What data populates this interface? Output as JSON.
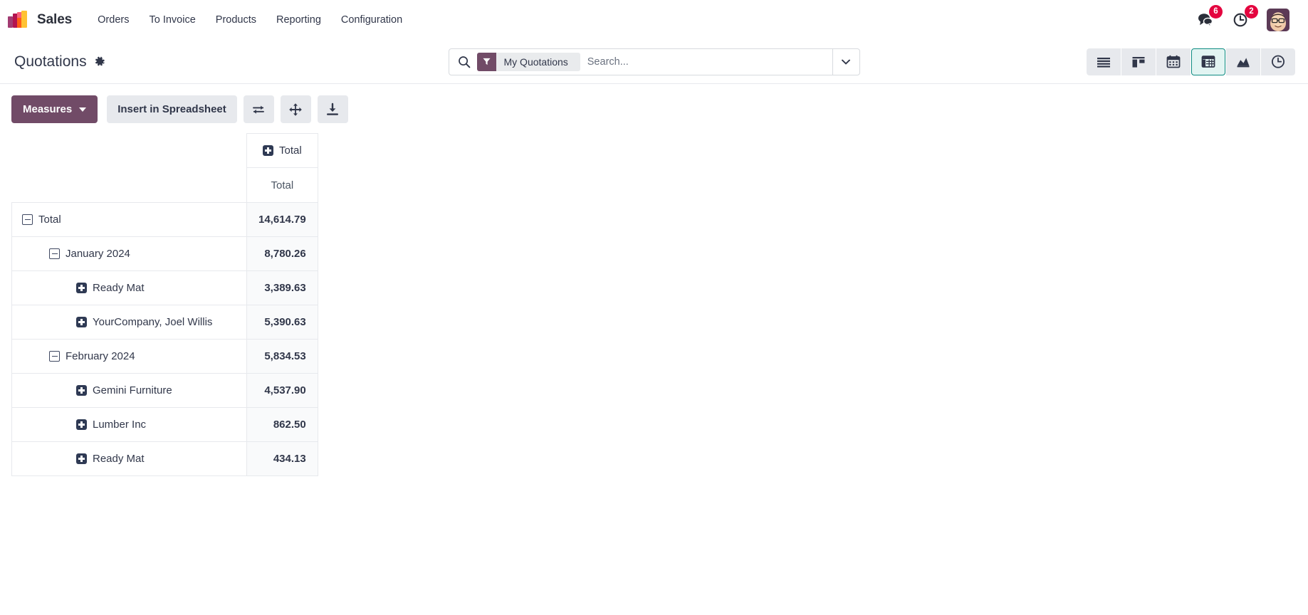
{
  "navbar": {
    "logo_name": "sales-app-logo",
    "app_name": "Sales",
    "menu_items": [
      {
        "label": "Orders"
      },
      {
        "label": "To Invoice"
      },
      {
        "label": "Products"
      },
      {
        "label": "Reporting"
      },
      {
        "label": "Configuration"
      }
    ],
    "messages_badge": "6",
    "activities_badge": "2",
    "accent_purple": "#714b67",
    "badge_red": "#e4053f"
  },
  "control_panel": {
    "title": "Quotations",
    "search": {
      "facet_label": "My Quotations",
      "placeholder": "Search..."
    },
    "views": [
      {
        "name": "list",
        "active": false
      },
      {
        "name": "kanban",
        "active": false
      },
      {
        "name": "calendar",
        "active": false
      },
      {
        "name": "pivot",
        "active": true
      },
      {
        "name": "graph",
        "active": false
      },
      {
        "name": "activity",
        "active": false
      }
    ],
    "active_view_color": "#0d8b81"
  },
  "toolbar": {
    "measures_label": "Measures",
    "insert_spreadsheet_label": "Insert in Spreadsheet",
    "flip_axis_title": "Flip axis",
    "expand_all_title": "Expand all",
    "download_title": "Download xlsx"
  },
  "pivot": {
    "column_header": "Total",
    "column_measure": "Total",
    "rows": [
      {
        "label": "Total",
        "value": "14,614.79",
        "state": "minus",
        "level": 1
      },
      {
        "label": "January 2024",
        "value": "8,780.26",
        "state": "minus",
        "level": 2
      },
      {
        "label": "Ready Mat",
        "value": "3,389.63",
        "state": "plus",
        "level": 3
      },
      {
        "label": "YourCompany, Joel Willis",
        "value": "5,390.63",
        "state": "plus",
        "level": 3
      },
      {
        "label": "February 2024",
        "value": "5,834.53",
        "state": "minus",
        "level": 2
      },
      {
        "label": "Gemini Furniture",
        "value": "4,537.90",
        "state": "plus",
        "level": 3
      },
      {
        "label": "Lumber Inc",
        "value": "862.50",
        "state": "plus",
        "level": 3
      },
      {
        "label": "Ready Mat",
        "value": "434.13",
        "state": "plus",
        "level": 3
      }
    ]
  }
}
